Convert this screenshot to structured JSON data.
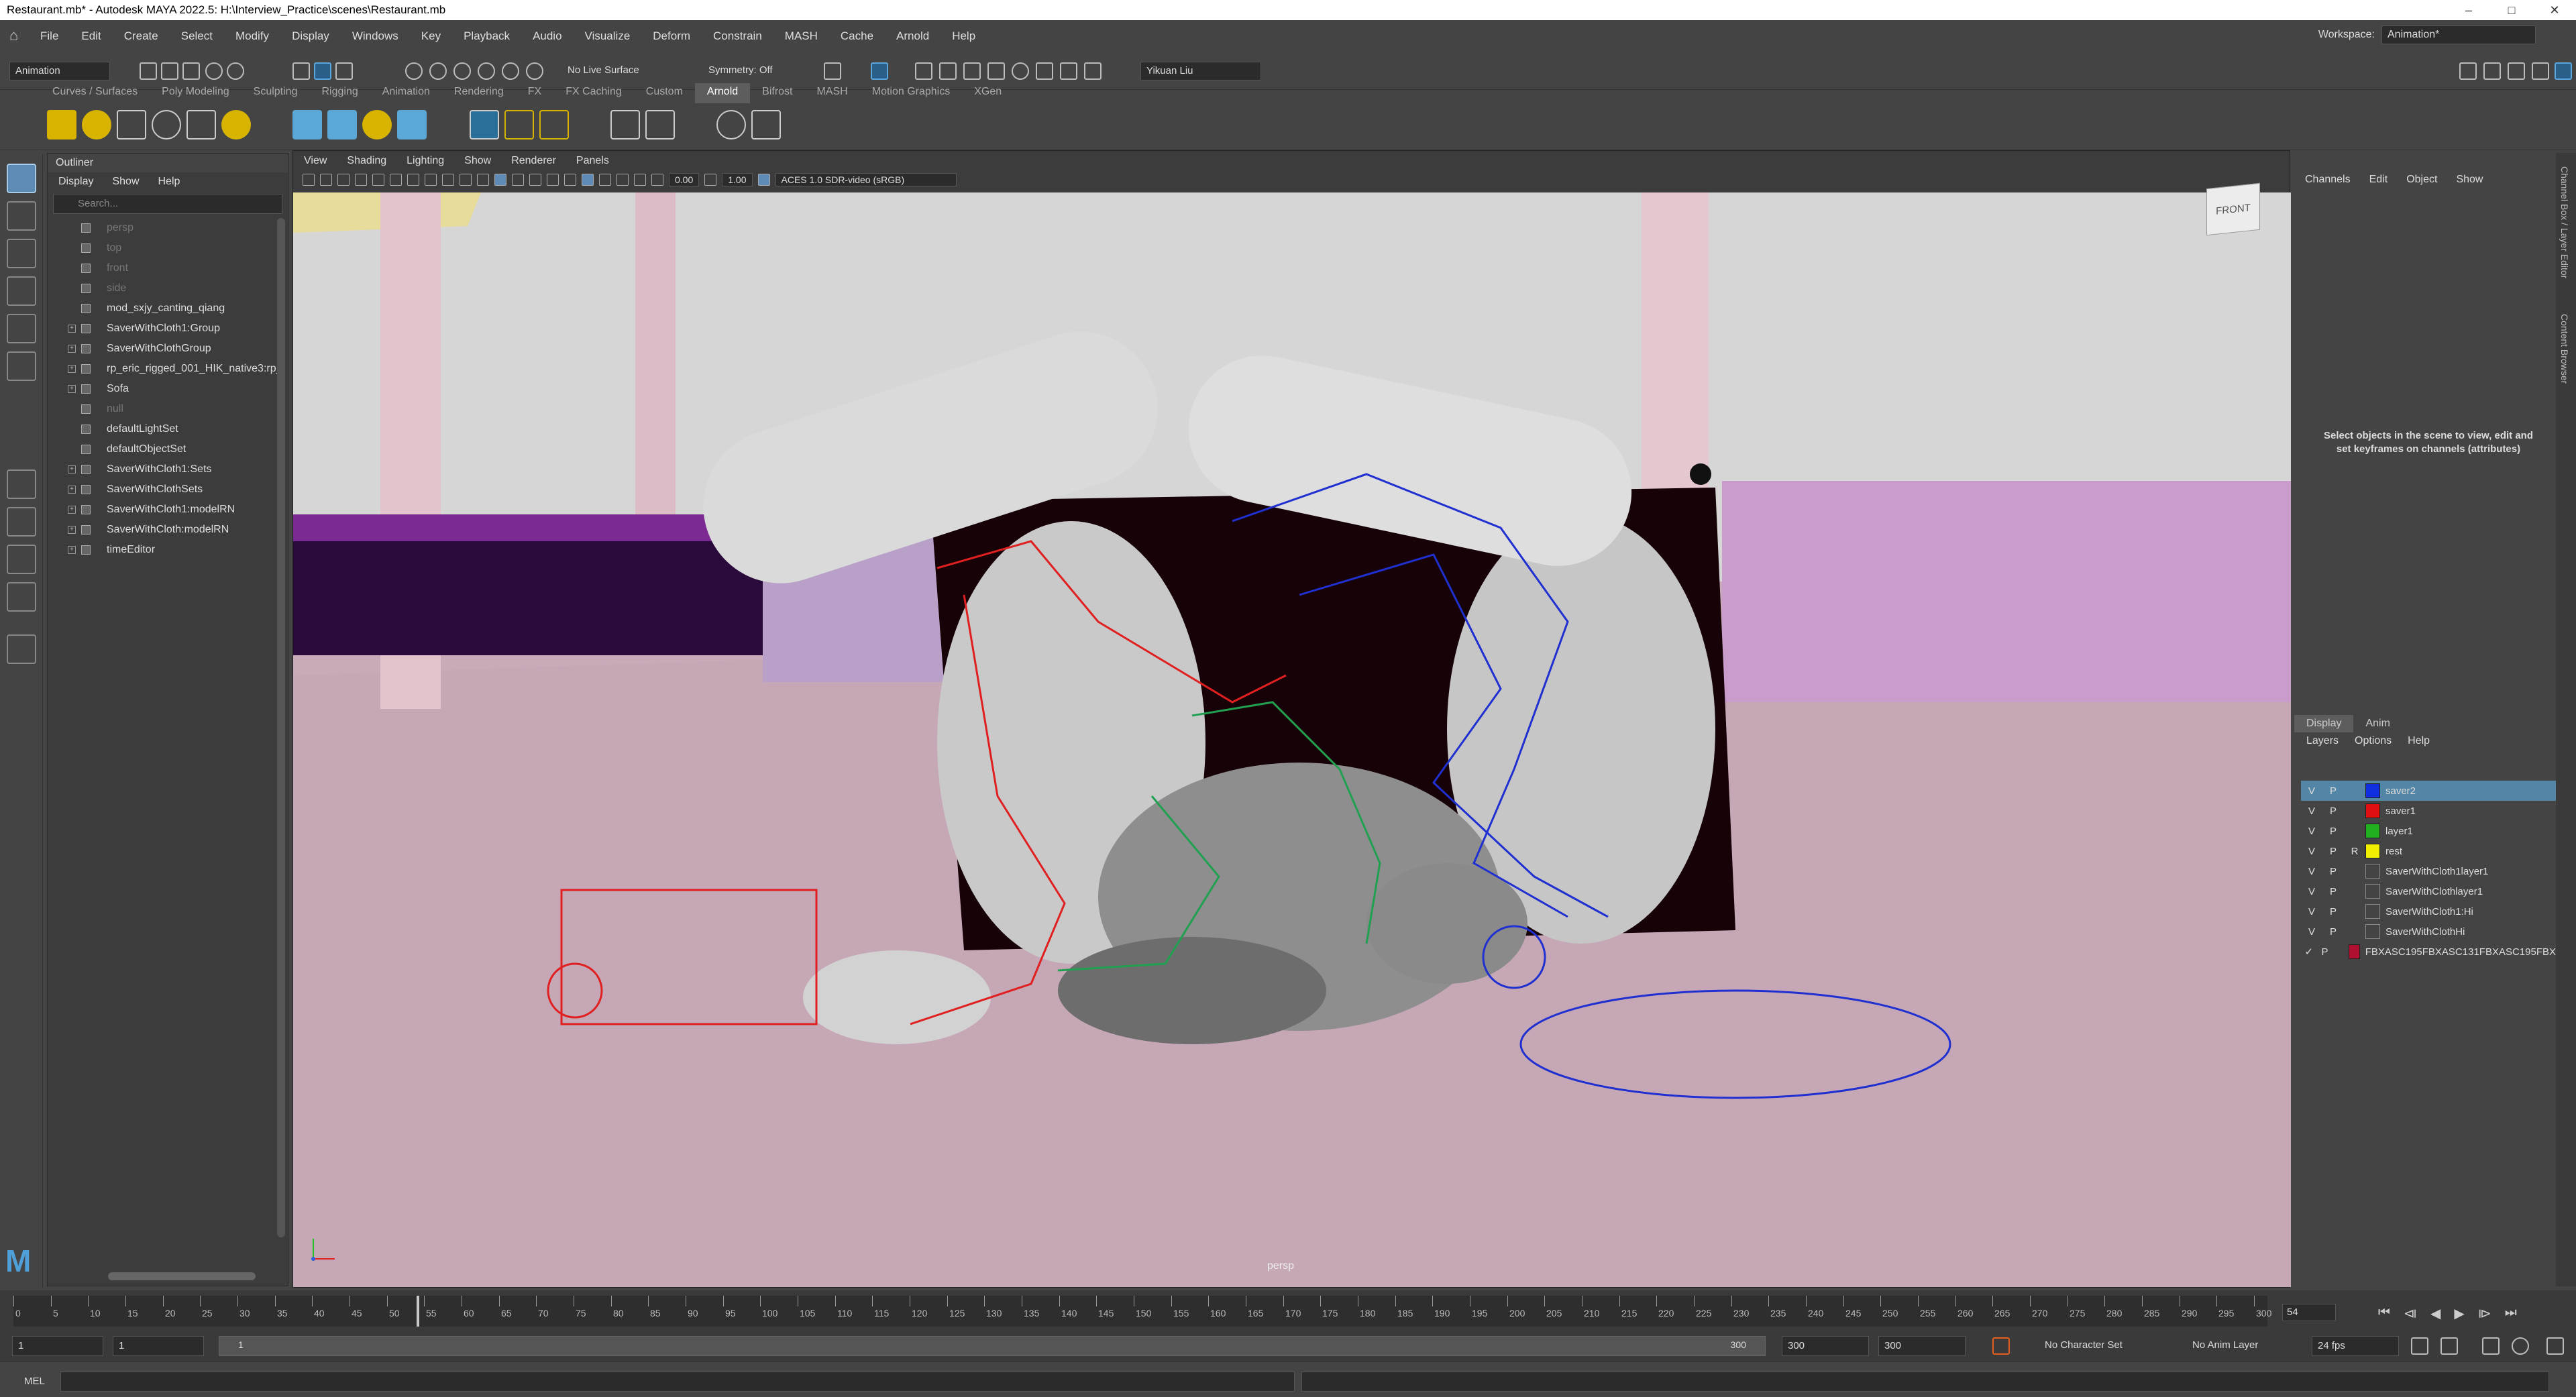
{
  "window": {
    "title": "Restaurant.mb* - Autodesk MAYA 2022.5: H:\\Interview_Practice\\scenes\\Restaurant.mb",
    "minimize": "–",
    "maximize": "□",
    "close": "✕"
  },
  "menubar": {
    "items": [
      "File",
      "Edit",
      "Create",
      "Select",
      "Modify",
      "Display",
      "Windows",
      "Key",
      "Playback",
      "Audio",
      "Visualize",
      "Deform",
      "Constrain",
      "MASH",
      "Cache",
      "Arnold",
      "Help"
    ],
    "workspace_label": "Workspace:",
    "workspace_value": "Animation*"
  },
  "statusline": {
    "menuset": "Animation",
    "live_surface": "No Live Surface",
    "symmetry": "Symmetry: Off",
    "user": "Yikuan Liu"
  },
  "shelf": {
    "tabs": [
      "Curves / Surfaces",
      "Poly Modeling",
      "Sculpting",
      "Rigging",
      "Animation",
      "Rendering",
      "FX",
      "FX Caching",
      "Custom",
      "Arnold",
      "Bifrost",
      "MASH",
      "Motion Graphics",
      "XGen"
    ],
    "active_tab": "Arnold"
  },
  "outliner": {
    "title": "Outliner",
    "menu": [
      "Display",
      "Show",
      "Help"
    ],
    "search_placeholder": "Search...",
    "items": [
      {
        "label": "persp",
        "dim": true,
        "expand": ""
      },
      {
        "label": "top",
        "dim": true,
        "expand": ""
      },
      {
        "label": "front",
        "dim": true,
        "expand": ""
      },
      {
        "label": "side",
        "dim": true,
        "expand": ""
      },
      {
        "label": "mod_sxjy_canting_qiang",
        "dim": false,
        "expand": ""
      },
      {
        "label": "SaverWithCloth1:Group",
        "dim": false,
        "expand": "+"
      },
      {
        "label": "SaverWithClothGroup",
        "dim": false,
        "expand": "+"
      },
      {
        "label": "rp_eric_rigged_001_HIK_native3:rp_",
        "dim": false,
        "expand": "+"
      },
      {
        "label": "Sofa",
        "dim": false,
        "expand": "+"
      },
      {
        "label": "null",
        "dim": true,
        "expand": ""
      },
      {
        "label": "defaultLightSet",
        "dim": false,
        "expand": ""
      },
      {
        "label": "defaultObjectSet",
        "dim": false,
        "expand": ""
      },
      {
        "label": "SaverWithCloth1:Sets",
        "dim": false,
        "expand": "+"
      },
      {
        "label": "SaverWithClothSets",
        "dim": false,
        "expand": "+"
      },
      {
        "label": "SaverWithCloth1:modelRN",
        "dim": false,
        "expand": "+"
      },
      {
        "label": "SaverWithCloth:modelRN",
        "dim": false,
        "expand": "+"
      },
      {
        "label": "timeEditor",
        "dim": false,
        "expand": "+"
      }
    ]
  },
  "viewport": {
    "menu": [
      "View",
      "Shading",
      "Lighting",
      "Show",
      "Renderer",
      "Panels"
    ],
    "exposure": "0.00",
    "gamma": "1.00",
    "color_space": "ACES 1.0 SDR-video (sRGB)",
    "camera": "persp",
    "viewcube": "FRONT"
  },
  "channelbox": {
    "menu": [
      "Channels",
      "Edit",
      "Object",
      "Show"
    ],
    "message": "Select objects in the scene to view, edit and set keyframes on channels (attributes)",
    "side_tabs": [
      "Channel Box / Layer Editor",
      "Content Browser"
    ]
  },
  "layers": {
    "tabs": [
      "Display",
      "Anim"
    ],
    "menu": [
      "Layers",
      "Options",
      "Help"
    ],
    "items": [
      {
        "v": "V",
        "p": "P",
        "r": "",
        "name": "saver2",
        "color": "#1030e0",
        "selected": true
      },
      {
        "v": "V",
        "p": "P",
        "r": "",
        "name": "saver1",
        "color": "#e01010",
        "selected": false
      },
      {
        "v": "V",
        "p": "P",
        "r": "",
        "name": "layer1",
        "color": "#20b020",
        "selected": false
      },
      {
        "v": "V",
        "p": "P",
        "r": "R",
        "name": "rest",
        "color": "#f0f000",
        "selected": false
      },
      {
        "v": "V",
        "p": "P",
        "r": "",
        "name": "SaverWithCloth1layer1",
        "color": "",
        "selected": false
      },
      {
        "v": "V",
        "p": "P",
        "r": "",
        "name": "SaverWithClothlayer1",
        "color": "",
        "selected": false
      },
      {
        "v": "V",
        "p": "P",
        "r": "",
        "name": "SaverWithCloth1:Hi",
        "color": "",
        "selected": false
      },
      {
        "v": "V",
        "p": "P",
        "r": "",
        "name": "SaverWithClothHi",
        "color": "",
        "selected": false
      },
      {
        "v": "✓",
        "p": "P",
        "r": "",
        "name": "FBXASC195FBXASC131FBXASC195FBX",
        "color": "#b01030",
        "selected": false
      }
    ]
  },
  "timeline": {
    "ticks": [
      "0",
      "5",
      "10",
      "15",
      "20",
      "25",
      "30",
      "35",
      "40",
      "45",
      "50",
      "55",
      "60",
      "65",
      "70",
      "75",
      "80",
      "85",
      "90",
      "95",
      "100",
      "105",
      "110",
      "115",
      "120",
      "125",
      "130",
      "135",
      "140",
      "145",
      "150",
      "155",
      "160",
      "165",
      "170",
      "175",
      "180",
      "185",
      "190",
      "195",
      "200",
      "205",
      "210",
      "215",
      "220",
      "225",
      "230",
      "235",
      "240",
      "245",
      "250",
      "255",
      "260",
      "265",
      "270",
      "275",
      "280",
      "285",
      "290",
      "295",
      "300"
    ],
    "current_frame": "54",
    "play_icons": [
      "⏮",
      "⧏",
      "◀",
      "▶",
      "⧐",
      "⏭"
    ]
  },
  "range": {
    "start": "1",
    "anim_start": "1",
    "range_low": "1",
    "range_high": "300",
    "end": "300",
    "anim_end": "300",
    "character_set": "No Character Set",
    "anim_layer": "No Anim Layer",
    "fps": "24 fps"
  },
  "commandline": {
    "label": "MEL"
  },
  "colors": {
    "accent": "#5285a6",
    "rig_red": "#e02020",
    "rig_blue": "#2030d0",
    "rig_green": "#20a050",
    "floor": "#c9aab9",
    "wall": "#d8d8d8",
    "sofa": "#c8a0cc",
    "couch_dark": "#1a0508"
  }
}
